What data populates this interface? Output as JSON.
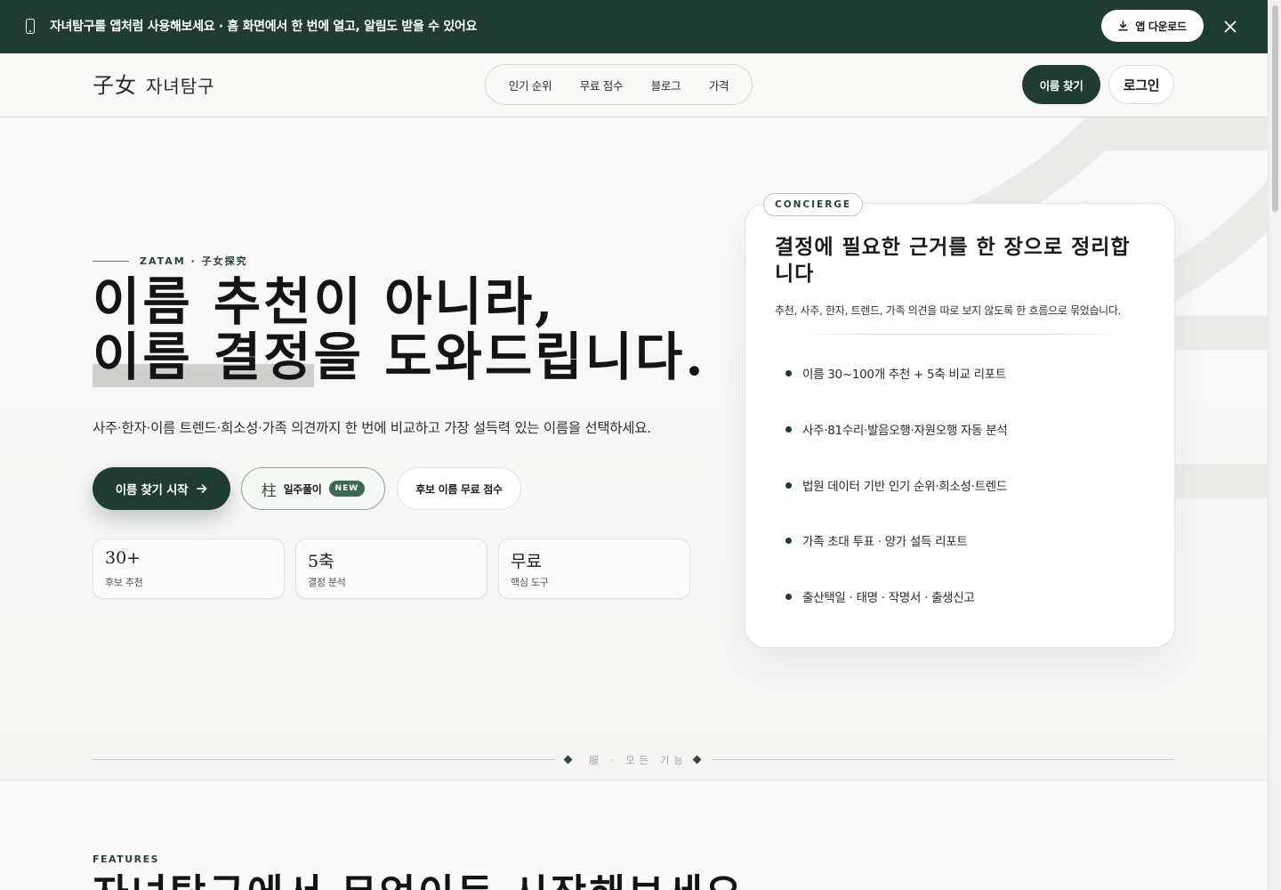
{
  "banner": {
    "message": "자녀탐구를 앱처럼 사용해보세요 · 홈 화면에서 한 번에 열고, 알림도 받을 수 있어요",
    "download_label": "앱 다운로드",
    "icons": [
      "phone-icon",
      "download-icon",
      "close-icon"
    ]
  },
  "header": {
    "logo_hanja": "子女",
    "logo_brand": "자녀탐구",
    "nav": [
      "인기 순위",
      "무료 점수",
      "블로그",
      "가격"
    ],
    "find_name_label": "이름 찾기",
    "login_label": "로그인"
  },
  "hero": {
    "watermark": "名",
    "eyebrow": "ZATAM · 子女探究",
    "headline_line1": "이름 추천이 아니라,",
    "headline_line2_highlight": "이름 결정",
    "headline_line2_rest": "을 도와드립니다.",
    "subtitle": "사주·한자·이름 트렌드·희소성·가족 의견까지 한 번에 비교하고 가장 설득력 있는 이름을 선택하세요.",
    "buttons": {
      "start_label": "이름 찾기 시작",
      "saju_hanja": "柱",
      "saju_label": "일주풀이",
      "saju_badge": "NEW",
      "score_label": "후보 이름 무료 점수"
    },
    "stats": [
      {
        "value": "30+",
        "caption": "후보 추천"
      },
      {
        "value": "5축",
        "caption": "결정 분석"
      },
      {
        "value": "무료",
        "caption": "핵심 도구"
      }
    ]
  },
  "concierge": {
    "tag": "CONCIERGE",
    "title": "결정에 필요한 근거를 한 장으로 정리합니다",
    "description": "추천, 사주, 한자, 트렌드, 가족 의견을 따로 보지 않도록 한 흐름으로 묶었습니다.",
    "features": [
      "이름 30~100개 추천 + 5축 비교 리포트",
      "사주·81수리·발음오행·자원오행 자동 분석",
      "법원 데이터 기반 인기 순위·희소성·트렌드",
      "가족 초대 투표 · 양가 설득 리포트",
      "출산택일 · 태명 · 작명서 · 출생신고"
    ]
  },
  "section_divider": {
    "label": "服 · 모든 기능"
  },
  "features": {
    "kicker": "FEATURES",
    "heading": "자녀탐구에서 무엇이든 시작해보세요"
  },
  "colors": {
    "brand_green": "#203b32",
    "accent_green": "#3d6856",
    "background": "#f7f7f6"
  }
}
